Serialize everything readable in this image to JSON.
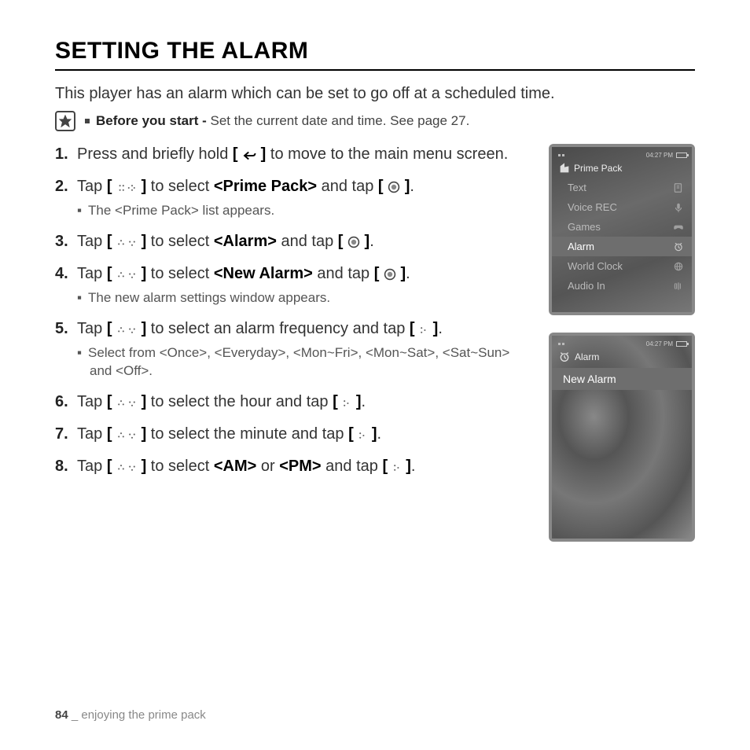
{
  "title": "SETTING THE ALARM",
  "intro": "This player has an alarm which can be set to go off at a scheduled time.",
  "note_label": "Before you start - ",
  "note_text": "Set the current date and time. See page 27.",
  "steps": [
    {
      "pre": "Press and briefly hold ",
      "post": " to move to the main menu screen.",
      "sub": null
    },
    {
      "pre": "Tap ",
      "mid": " to select ",
      "bold": "<Prime Pack>",
      "mid2": " and tap ",
      "post": ".",
      "sub": "The <Prime Pack> list appears."
    },
    {
      "pre": "Tap ",
      "mid": " to select ",
      "bold": "<Alarm>",
      "mid2": " and tap ",
      "post": ".",
      "sub": null
    },
    {
      "pre": "Tap ",
      "mid": " to select ",
      "bold": "<New Alarm>",
      "mid2": " and tap ",
      "post": ".",
      "sub": "The new alarm settings window appears."
    },
    {
      "pre": "Tap ",
      "mid": " to select an alarm frequency and tap ",
      "post": ".",
      "sub": "Select from <Once>, <Everyday>, <Mon~Fri>, <Mon~Sat>, <Sat~Sun> and <Off>."
    },
    {
      "pre": "Tap ",
      "mid": " to select the hour and tap ",
      "post": ".",
      "sub": null
    },
    {
      "pre": "Tap ",
      "mid": " to select the minute and tap ",
      "post": ".",
      "sub": null
    },
    {
      "pre": "Tap ",
      "mid": " to select ",
      "bold": "<AM>",
      "mid2": " or ",
      "bold2": "<PM>",
      "mid3": " and tap ",
      "post": ".",
      "sub": null
    }
  ],
  "device": {
    "time": "04:27 PM",
    "screen1": {
      "title": "Prime Pack",
      "items": [
        {
          "label": "Text",
          "selected": false
        },
        {
          "label": "Voice REC",
          "selected": false
        },
        {
          "label": "Games",
          "selected": false
        },
        {
          "label": "Alarm",
          "selected": true
        },
        {
          "label": "World Clock",
          "selected": false
        },
        {
          "label": "Audio In",
          "selected": false
        }
      ]
    },
    "screen2": {
      "title": "Alarm",
      "new_alarm": "New Alarm"
    }
  },
  "footer": {
    "page": "84",
    "sep": " _ ",
    "section": "enjoying the prime pack"
  }
}
